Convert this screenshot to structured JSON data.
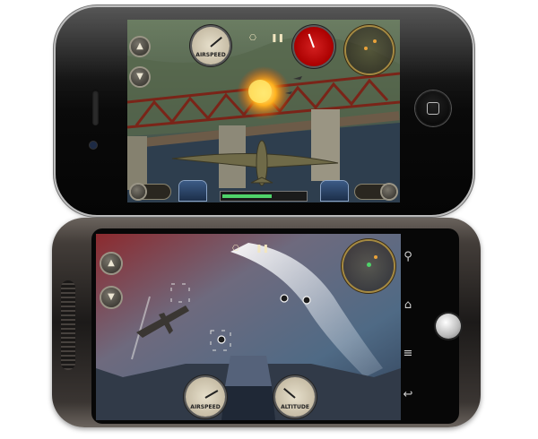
{
  "iphone": {
    "hud": {
      "pause_symbol": "❚❚",
      "camera_symbol": "⎔",
      "throttle_level": 0.5,
      "health_level": 0.6,
      "gauge_left_label": "AIRSPEED"
    }
  },
  "android": {
    "nav_keys": {
      "search": "⚲",
      "home": "⌂",
      "menu": "≡",
      "back": "↩"
    },
    "hud": {
      "pause_symbol": "❚❚",
      "camera_symbol": "⎔",
      "gauge_left_label": "AIRSPEED",
      "gauge_right_label": "ALTITUDE"
    }
  },
  "colors": {
    "hud_text": "#f2e6c0",
    "radar_ring": "#a58a43",
    "red_gauge": "#d42020",
    "health_bar": "#4fd36a"
  }
}
